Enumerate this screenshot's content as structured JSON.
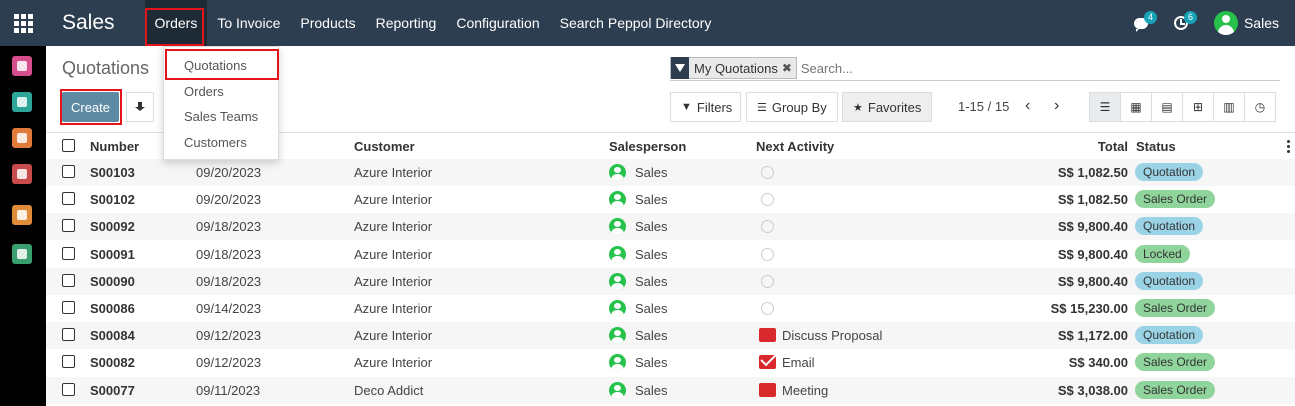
{
  "app": {
    "title": "Sales",
    "menu": [
      "Orders",
      "To Invoice",
      "Products",
      "Reporting",
      "Configuration",
      "Search Peppol Directory"
    ],
    "chat_badge": "4",
    "activity_badge": "6",
    "user": "Sales"
  },
  "orders_dropdown": [
    "Quotations",
    "Orders",
    "Sales Teams",
    "Customers"
  ],
  "breadcrumb": "Quotations",
  "toolbar": {
    "create_label": "Create"
  },
  "search": {
    "facet": "My Quotations",
    "placeholder": "Search..."
  },
  "controls": {
    "filters": "Filters",
    "group_by": "Group By",
    "favorites": "Favorites",
    "pager": "1-15 / 15"
  },
  "table": {
    "columns": [
      "Number",
      "Customer",
      "Salesperson",
      "Next Activity",
      "Total",
      "Status"
    ],
    "rows": [
      {
        "number": "S00103",
        "date": "09/20/2023",
        "customer": "Azure Interior",
        "salesperson": "Sales",
        "activity": "",
        "total": "S$ 1,082.50",
        "status": "Quotation"
      },
      {
        "number": "S00102",
        "date": "09/20/2023",
        "customer": "Azure Interior",
        "salesperson": "Sales",
        "activity": "",
        "total": "S$ 1,082.50",
        "status": "Sales Order"
      },
      {
        "number": "S00092",
        "date": "09/18/2023",
        "customer": "Azure Interior",
        "salesperson": "Sales",
        "activity": "",
        "total": "S$ 9,800.40",
        "status": "Quotation"
      },
      {
        "number": "S00091",
        "date": "09/18/2023",
        "customer": "Azure Interior",
        "salesperson": "Sales",
        "activity": "",
        "total": "S$ 9,800.40",
        "status": "Locked"
      },
      {
        "number": "S00090",
        "date": "09/18/2023",
        "customer": "Azure Interior",
        "salesperson": "Sales",
        "activity": "",
        "total": "S$ 9,800.40",
        "status": "Quotation"
      },
      {
        "number": "S00086",
        "date": "09/14/2023",
        "customer": "Azure Interior",
        "salesperson": "Sales",
        "activity": "",
        "total": "S$ 15,230.00",
        "status": "Sales Order"
      },
      {
        "number": "S00084",
        "date": "09/12/2023",
        "customer": "Azure Interior",
        "salesperson": "Sales",
        "activity": "Discuss Proposal",
        "total": "S$ 1,172.00",
        "status": "Quotation"
      },
      {
        "number": "S00082",
        "date": "09/12/2023",
        "customer": "Azure Interior",
        "salesperson": "Sales",
        "activity": "Email",
        "total": "S$ 340.00",
        "status": "Sales Order"
      },
      {
        "number": "S00077",
        "date": "09/11/2023",
        "customer": "Deco Addict",
        "salesperson": "Sales",
        "activity": "Meeting",
        "total": "S$ 3,038.00",
        "status": "Sales Order"
      }
    ]
  }
}
